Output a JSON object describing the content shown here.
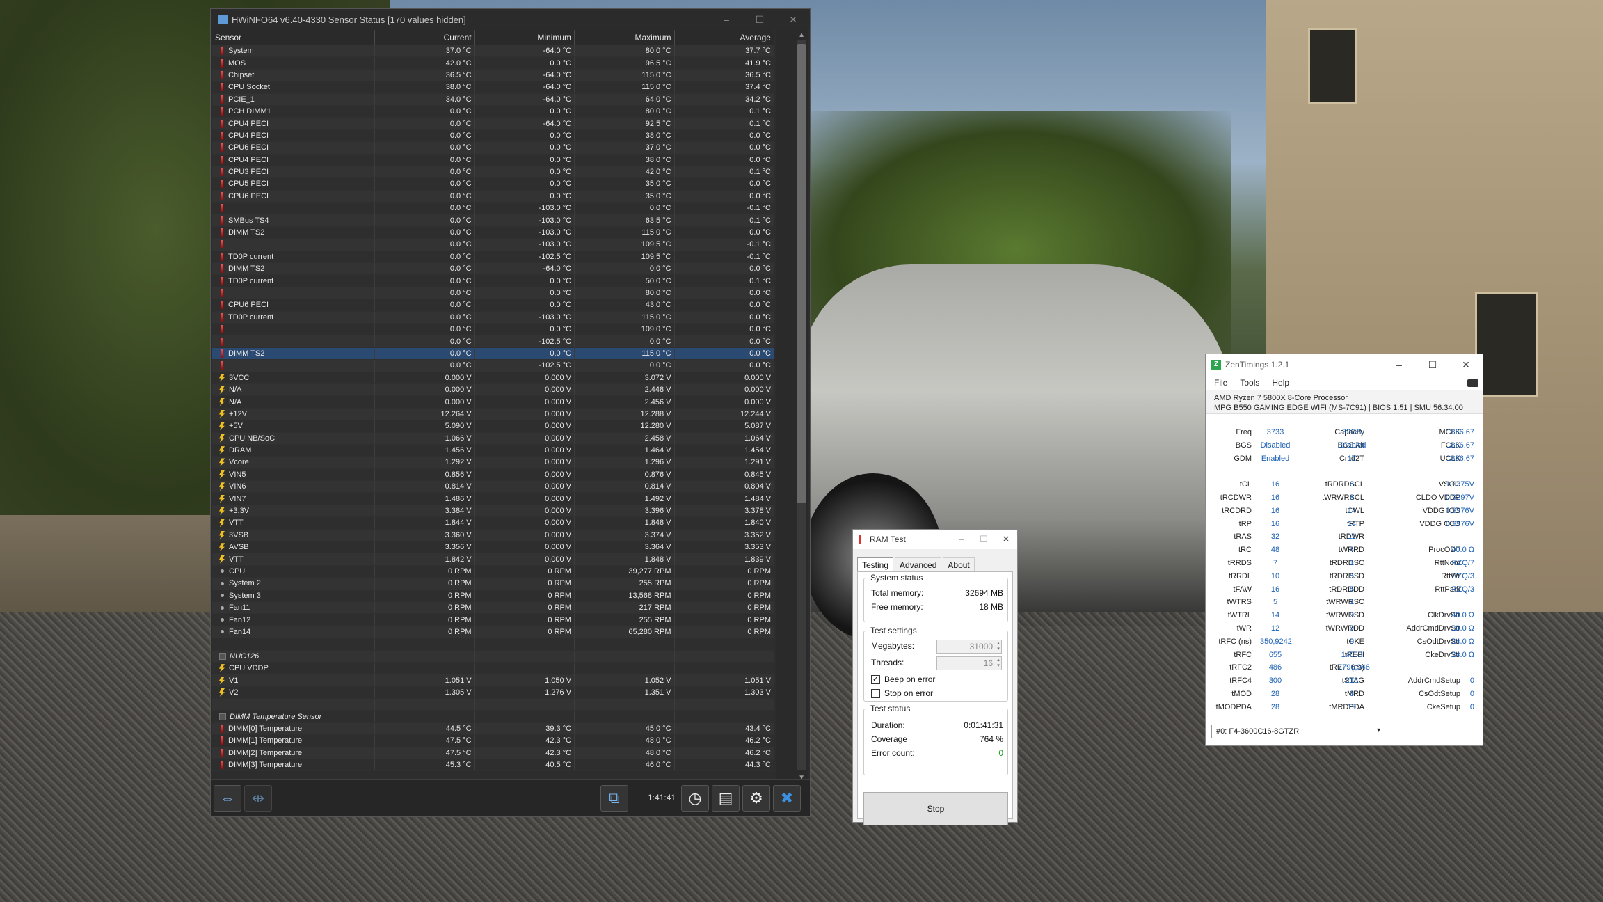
{
  "hwinfo": {
    "title": "HWiNFO64 v6.40-4330 Sensor Status [170 values hidden]",
    "columns": [
      "Sensor",
      "Current",
      "Minimum",
      "Maximum",
      "Average"
    ],
    "rows": [
      {
        "k": "temp",
        "n": "System",
        "c": "37.0 °C",
        "mi": "-64.0 °C",
        "ma": "80.0 °C",
        "av": "37.7 °C"
      },
      {
        "k": "temp",
        "n": "MOS",
        "c": "42.0 °C",
        "mi": "0.0 °C",
        "ma": "96.5 °C",
        "av": "41.9 °C"
      },
      {
        "k": "temp",
        "n": "Chipset",
        "c": "36.5 °C",
        "mi": "-64.0 °C",
        "ma": "115.0 °C",
        "av": "36.5 °C"
      },
      {
        "k": "temp",
        "n": "CPU Socket",
        "c": "38.0 °C",
        "mi": "-64.0 °C",
        "ma": "115.0 °C",
        "av": "37.4 °C"
      },
      {
        "k": "temp",
        "n": "PCIE_1",
        "c": "34.0 °C",
        "mi": "-64.0 °C",
        "ma": "64.0 °C",
        "av": "34.2 °C"
      },
      {
        "k": "temp",
        "n": "PCH DIMM1",
        "c": "0.0 °C",
        "mi": "0.0 °C",
        "ma": "80.0 °C",
        "av": "0.1 °C"
      },
      {
        "k": "temp",
        "n": "CPU4 PECI",
        "c": "0.0 °C",
        "mi": "-64.0 °C",
        "ma": "92.5 °C",
        "av": "0.1 °C"
      },
      {
        "k": "temp",
        "n": "CPU4 PECI",
        "c": "0.0 °C",
        "mi": "0.0 °C",
        "ma": "38.0 °C",
        "av": "0.0 °C"
      },
      {
        "k": "temp",
        "n": "CPU6 PECI",
        "c": "0.0 °C",
        "mi": "0.0 °C",
        "ma": "37.0 °C",
        "av": "0.0 °C"
      },
      {
        "k": "temp",
        "n": "CPU4 PECI",
        "c": "0.0 °C",
        "mi": "0.0 °C",
        "ma": "38.0 °C",
        "av": "0.0 °C"
      },
      {
        "k": "temp",
        "n": "CPU3 PECI",
        "c": "0.0 °C",
        "mi": "0.0 °C",
        "ma": "42.0 °C",
        "av": "0.1 °C"
      },
      {
        "k": "temp",
        "n": "CPU5 PECI",
        "c": "0.0 °C",
        "mi": "0.0 °C",
        "ma": "35.0 °C",
        "av": "0.0 °C"
      },
      {
        "k": "temp",
        "n": "CPU6 PECI",
        "c": "0.0 °C",
        "mi": "0.0 °C",
        "ma": "35.0 °C",
        "av": "0.0 °C"
      },
      {
        "k": "temp",
        "n": "",
        "c": "0.0 °C",
        "mi": "-103.0 °C",
        "ma": "0.0 °C",
        "av": "-0.1 °C"
      },
      {
        "k": "temp",
        "n": "SMBus TS4",
        "c": "0.0 °C",
        "mi": "-103.0 °C",
        "ma": "63.5 °C",
        "av": "0.1 °C"
      },
      {
        "k": "temp",
        "n": "DIMM TS2",
        "c": "0.0 °C",
        "mi": "-103.0 °C",
        "ma": "115.0 °C",
        "av": "0.0 °C"
      },
      {
        "k": "temp",
        "n": "",
        "c": "0.0 °C",
        "mi": "-103.0 °C",
        "ma": "109.5 °C",
        "av": "-0.1 °C"
      },
      {
        "k": "temp",
        "n": "TD0P current",
        "c": "0.0 °C",
        "mi": "-102.5 °C",
        "ma": "109.5 °C",
        "av": "-0.1 °C"
      },
      {
        "k": "temp",
        "n": "DIMM TS2",
        "c": "0.0 °C",
        "mi": "-64.0 °C",
        "ma": "0.0 °C",
        "av": "0.0 °C"
      },
      {
        "k": "temp",
        "n": "TD0P current",
        "c": "0.0 °C",
        "mi": "0.0 °C",
        "ma": "50.0 °C",
        "av": "0.1 °C"
      },
      {
        "k": "temp",
        "n": "",
        "c": "0.0 °C",
        "mi": "0.0 °C",
        "ma": "80.0 °C",
        "av": "0.0 °C"
      },
      {
        "k": "temp",
        "n": "CPU6 PECI",
        "c": "0.0 °C",
        "mi": "0.0 °C",
        "ma": "43.0 °C",
        "av": "0.0 °C"
      },
      {
        "k": "temp",
        "n": "TD0P current",
        "c": "0.0 °C",
        "mi": "-103.0 °C",
        "ma": "115.0 °C",
        "av": "0.0 °C"
      },
      {
        "k": "temp",
        "n": "",
        "c": "0.0 °C",
        "mi": "0.0 °C",
        "ma": "109.0 °C",
        "av": "0.0 °C"
      },
      {
        "k": "temp",
        "n": "",
        "c": "0.0 °C",
        "mi": "-102.5 °C",
        "ma": "0.0 °C",
        "av": "0.0 °C"
      },
      {
        "k": "temp",
        "n": "DIMM TS2",
        "c": "0.0 °C",
        "mi": "0.0 °C",
        "ma": "115.0 °C",
        "av": "0.0 °C",
        "sel": true
      },
      {
        "k": "temp",
        "n": "",
        "c": "0.0 °C",
        "mi": "-102.5 °C",
        "ma": "0.0 °C",
        "av": "0.0 °C"
      },
      {
        "k": "volt",
        "n": "3VCC",
        "c": "0.000 V",
        "mi": "0.000 V",
        "ma": "3.072 V",
        "av": "0.000 V"
      },
      {
        "k": "volt",
        "n": "N/A",
        "c": "0.000 V",
        "mi": "0.000 V",
        "ma": "2.448 V",
        "av": "0.000 V"
      },
      {
        "k": "volt",
        "n": "N/A",
        "c": "0.000 V",
        "mi": "0.000 V",
        "ma": "2.456 V",
        "av": "0.000 V"
      },
      {
        "k": "volt",
        "n": "+12V",
        "c": "12.264 V",
        "mi": "0.000 V",
        "ma": "12.288 V",
        "av": "12.244 V"
      },
      {
        "k": "volt",
        "n": "+5V",
        "c": "5.090 V",
        "mi": "0.000 V",
        "ma": "12.280 V",
        "av": "5.087 V"
      },
      {
        "k": "volt",
        "n": "CPU NB/SoC",
        "c": "1.066 V",
        "mi": "0.000 V",
        "ma": "2.458 V",
        "av": "1.064 V"
      },
      {
        "k": "volt",
        "n": "DRAM",
        "c": "1.456 V",
        "mi": "0.000 V",
        "ma": "1.464 V",
        "av": "1.454 V"
      },
      {
        "k": "volt",
        "n": "Vcore",
        "c": "1.292 V",
        "mi": "0.000 V",
        "ma": "1.296 V",
        "av": "1.291 V"
      },
      {
        "k": "volt",
        "n": "VIN5",
        "c": "0.856 V",
        "mi": "0.000 V",
        "ma": "0.876 V",
        "av": "0.845 V"
      },
      {
        "k": "volt",
        "n": "VIN6",
        "c": "0.814 V",
        "mi": "0.000 V",
        "ma": "0.814 V",
        "av": "0.804 V"
      },
      {
        "k": "volt",
        "n": "VIN7",
        "c": "1.486 V",
        "mi": "0.000 V",
        "ma": "1.492 V",
        "av": "1.484 V"
      },
      {
        "k": "volt",
        "n": "+3.3V",
        "c": "3.384 V",
        "mi": "0.000 V",
        "ma": "3.396 V",
        "av": "3.378 V"
      },
      {
        "k": "volt",
        "n": "VTT",
        "c": "1.844 V",
        "mi": "0.000 V",
        "ma": "1.848 V",
        "av": "1.840 V"
      },
      {
        "k": "volt",
        "n": "3VSB",
        "c": "3.360 V",
        "mi": "0.000 V",
        "ma": "3.374 V",
        "av": "3.352 V"
      },
      {
        "k": "volt",
        "n": "AVSB",
        "c": "3.356 V",
        "mi": "0.000 V",
        "ma": "3.364 V",
        "av": "3.353 V"
      },
      {
        "k": "volt",
        "n": "VTT",
        "c": "1.842 V",
        "mi": "0.000 V",
        "ma": "1.848 V",
        "av": "1.839 V"
      },
      {
        "k": "fan",
        "n": "CPU",
        "c": "0 RPM",
        "mi": "0 RPM",
        "ma": "39,277 RPM",
        "av": "0 RPM"
      },
      {
        "k": "fan",
        "n": "System 2",
        "c": "0 RPM",
        "mi": "0 RPM",
        "ma": "255 RPM",
        "av": "0 RPM"
      },
      {
        "k": "fan",
        "n": "System 3",
        "c": "0 RPM",
        "mi": "0 RPM",
        "ma": "13,568 RPM",
        "av": "0 RPM"
      },
      {
        "k": "fan",
        "n": "Fan11",
        "c": "0 RPM",
        "mi": "0 RPM",
        "ma": "217 RPM",
        "av": "0 RPM"
      },
      {
        "k": "fan",
        "n": "Fan12",
        "c": "0 RPM",
        "mi": "0 RPM",
        "ma": "255 RPM",
        "av": "0 RPM"
      },
      {
        "k": "fan",
        "n": "Fan14",
        "c": "0 RPM",
        "mi": "0 RPM",
        "ma": "65,280 RPM",
        "av": "0 RPM"
      },
      {
        "k": "blank",
        "n": "",
        "c": "",
        "mi": "",
        "ma": "",
        "av": ""
      },
      {
        "k": "grp",
        "n": "NUC126",
        "c": "",
        "mi": "",
        "ma": "",
        "av": ""
      },
      {
        "k": "volt",
        "n": "CPU VDDP",
        "c": "",
        "mi": "",
        "ma": "",
        "av": ""
      },
      {
        "k": "volt",
        "n": "V1",
        "c": "1.051 V",
        "mi": "1.050 V",
        "ma": "1.052 V",
        "av": "1.051 V"
      },
      {
        "k": "volt",
        "n": "V2",
        "c": "1.305 V",
        "mi": "1.276 V",
        "ma": "1.351 V",
        "av": "1.303 V"
      },
      {
        "k": "blank",
        "n": "",
        "c": "",
        "mi": "",
        "ma": "",
        "av": ""
      },
      {
        "k": "grp",
        "n": "DIMM Temperature Sensor",
        "c": "",
        "mi": "",
        "ma": "",
        "av": ""
      },
      {
        "k": "temp",
        "n": "DIMM[0] Temperature",
        "c": "44.5 °C",
        "mi": "39.3 °C",
        "ma": "45.0 °C",
        "av": "43.4 °C"
      },
      {
        "k": "temp",
        "n": "DIMM[1] Temperature",
        "c": "47.5 °C",
        "mi": "42.3 °C",
        "ma": "48.0 °C",
        "av": "46.2 °C"
      },
      {
        "k": "temp",
        "n": "DIMM[2] Temperature",
        "c": "47.5 °C",
        "mi": "42.3 °C",
        "ma": "48.0 °C",
        "av": "46.2 °C"
      },
      {
        "k": "temp",
        "n": "DIMM[3] Temperature",
        "c": "45.3 °C",
        "mi": "40.5 °C",
        "ma": "46.0 °C",
        "av": "44.3 °C"
      }
    ],
    "elapsed": "1:41:41"
  },
  "ramtest": {
    "title": "RAM Test",
    "tabs": [
      "Testing",
      "Advanced",
      "About"
    ],
    "system_status_label": "System status",
    "total_memory_label": "Total memory:",
    "total_memory": "32694 MB",
    "free_memory_label": "Free memory:",
    "free_memory": "18 MB",
    "test_settings_label": "Test settings",
    "megabytes_label": "Megabytes:",
    "megabytes": "31000",
    "threads_label": "Threads:",
    "threads": "16",
    "beep_label": "Beep on error",
    "stop_on_error_label": "Stop on error",
    "test_status_label": "Test status",
    "duration_label": "Duration:",
    "duration": "0:01:41:31",
    "coverage_label": "Coverage",
    "coverage": "764 %",
    "error_count_label": "Error count:",
    "error_count": "0",
    "stop_label": "Stop"
  },
  "zentimings": {
    "title": "ZenTimings 1.2.1",
    "menu": [
      "File",
      "Tools",
      "Help"
    ],
    "cpu": "AMD Ryzen 7 5800X 8-Core Processor",
    "board": "MPG B550 GAMING EDGE WIFI (MS-7C91) | BIOS 1.51 | SMU 56.34.00",
    "rows": [
      [
        "Freq",
        "3733",
        "Capacity",
        "32GB",
        "MCLK",
        "1866.67"
      ],
      [
        "BGS",
        "Disabled",
        "BGS Alt",
        "Enabled",
        "FCLK",
        "1866.67"
      ],
      [
        "GDM",
        "Enabled",
        "Cmd2T",
        "1T",
        "UCLK",
        "1866.67"
      ],
      [
        "",
        "",
        "",
        "",
        "",
        ""
      ],
      [
        "tCL",
        "16",
        "tRDRDSCL",
        "6",
        "VSOC",
        "1,0375V"
      ],
      [
        "tRCDWR",
        "16",
        "tWRWRSCL",
        "6",
        "CLDO VDDP",
        "0,9297V"
      ],
      [
        "tRCDRD",
        "16",
        "tCWL",
        "14",
        "VDDG IOD",
        "0,9976V"
      ],
      [
        "tRP",
        "16",
        "tRTP",
        "14",
        "VDDG CCD",
        "0,9976V"
      ],
      [
        "tRAS",
        "32",
        "tRDWR",
        "11",
        "",
        ""
      ],
      [
        "tRC",
        "48",
        "tWRRD",
        "4",
        "ProcODT",
        "40.0 Ω"
      ],
      [
        "tRRDS",
        "7",
        "tRDRDSC",
        "1",
        "RttNom",
        "RZQ/7"
      ],
      [
        "tRRDL",
        "10",
        "tRDRDSD",
        "5",
        "RttWr",
        "RZQ/3"
      ],
      [
        "tFAW",
        "16",
        "tRDRDDD",
        "5",
        "RttPark",
        "RZQ/3"
      ],
      [
        "tWTRS",
        "5",
        "tWRWRSC",
        "1",
        "",
        ""
      ],
      [
        "tWTRL",
        "14",
        "tWRWRSD",
        "9",
        "ClkDrvStr",
        "40.0 Ω"
      ],
      [
        "tWR",
        "12",
        "tWRWRDD",
        "9",
        "AddrCmdDrvStr",
        "20.0 Ω"
      ],
      [
        "tRFC (ns)",
        "350,9242",
        "tCKE",
        "9",
        "CsOdtDrvStr",
        "24.0 Ω"
      ],
      [
        "tRFC",
        "655",
        "tREFI",
        "14553",
        "CkeDrvStr",
        "24.0 Ω"
      ],
      [
        "tRFC2",
        "486",
        "tREFI (ns)",
        "7796,946",
        "",
        ""
      ],
      [
        "tRFC4",
        "300",
        "tSTAG",
        "218",
        "AddrCmdSetup",
        "0"
      ],
      [
        "tMOD",
        "28",
        "tMRD",
        "8",
        "CsOdtSetup",
        "0"
      ],
      [
        "tMODPDA",
        "28",
        "tMRDPDA",
        "19",
        "CkeSetup",
        "0"
      ]
    ],
    "dimm_select": "#0: F4-3600C16-8GTZR"
  }
}
